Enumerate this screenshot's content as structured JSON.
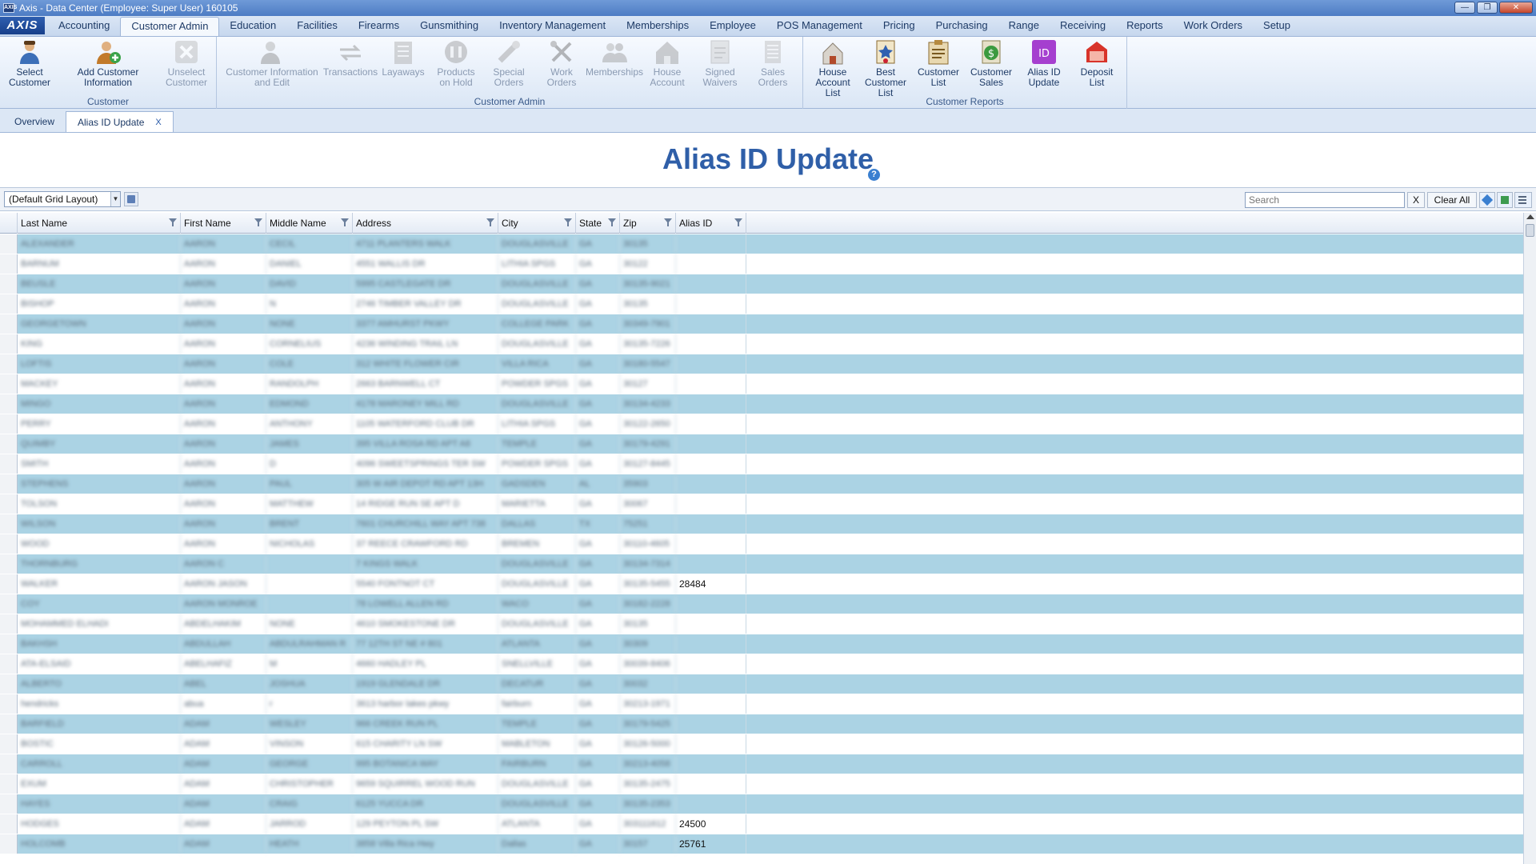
{
  "window": {
    "title": "Axis - Data Center  (Employee: Super User) 160105",
    "app_icon": "AXIS",
    "minimize": "—",
    "maximize": "❐",
    "close": "✕"
  },
  "menu": {
    "logo": "AXIS",
    "tabs": [
      "Accounting",
      "Customer Admin",
      "Education",
      "Facilities",
      "Firearms",
      "Gunsmithing",
      "Inventory Management",
      "Memberships",
      "Employee",
      "POS Management",
      "Pricing",
      "Purchasing",
      "Range",
      "Receiving",
      "Reports",
      "Work Orders",
      "Setup"
    ],
    "active": "Customer Admin"
  },
  "ribbon": {
    "customer": {
      "label": "Customer",
      "buttons": [
        {
          "label": "Select Customer",
          "icon": "person-icon"
        },
        {
          "label": "Add Customer Information",
          "icon": "add-person-icon"
        },
        {
          "label": "Unselect Customer",
          "icon": "x-icon"
        }
      ]
    },
    "customer_admin": {
      "label": "Customer Admin",
      "buttons": [
        {
          "label": "Customer Information and Edit",
          "icon": "person-edit-icon"
        },
        {
          "label": "Transactions",
          "icon": "transactions-icon"
        },
        {
          "label": "Layaways",
          "icon": "layaway-icon"
        },
        {
          "label": "Products on Hold",
          "icon": "hold-icon"
        },
        {
          "label": "Special Orders",
          "icon": "special-order-icon"
        },
        {
          "label": "Work Orders",
          "icon": "tools-icon"
        },
        {
          "label": "Memberships",
          "icon": "memberships-icon"
        },
        {
          "label": "House Account",
          "icon": "house-icon"
        },
        {
          "label": "Signed Waivers",
          "icon": "waiver-icon"
        },
        {
          "label": "Sales Orders",
          "icon": "sales-order-icon"
        }
      ]
    },
    "customer_reports": {
      "label": "Customer Reports",
      "buttons": [
        {
          "label": "House Account List",
          "icon": "house-list-icon"
        },
        {
          "label": "Best Customer List",
          "icon": "best-customer-icon"
        },
        {
          "label": "Customer List",
          "icon": "customer-list-icon"
        },
        {
          "label": "Customer Sales",
          "icon": "customer-sales-icon"
        },
        {
          "label": "Alias ID Update",
          "icon": "id-icon",
          "badge": "ID"
        },
        {
          "label": "Deposit List",
          "icon": "deposit-icon"
        }
      ]
    }
  },
  "doc_tabs": {
    "overview": "Overview",
    "alias": "Alias ID Update",
    "close": "X"
  },
  "page": {
    "title": "Alias ID Update",
    "help": "?"
  },
  "toolbar": {
    "layout": "(Default Grid Layout)",
    "search_placeholder": "Search",
    "clear_x": "X",
    "clear_all": "Clear All"
  },
  "grid": {
    "columns": [
      "Last Name",
      "First Name",
      "Middle Name",
      "Address",
      "City",
      "State",
      "Zip",
      "Alias ID"
    ],
    "rows": [
      [
        "ALEXANDER",
        "AARON",
        "CECIL",
        "4711 PLANTERS WALK",
        "DOUGLASVILLE",
        "GA",
        "30135",
        ""
      ],
      [
        "BARNUM",
        "AARON",
        "DANIEL",
        "4551 WALLIS DR",
        "LITHIA SPGS",
        "GA",
        "30122",
        ""
      ],
      [
        "BEUSLE",
        "AARON",
        "DAVID",
        "5995 CASTLEGATE DR",
        "DOUGLASVILLE",
        "GA",
        "30135-9021",
        ""
      ],
      [
        "BISHOP",
        "AARON",
        "N",
        "2746 TIMBER VALLEY DR",
        "DOUGLASVILLE",
        "GA",
        "30135",
        ""
      ],
      [
        "GEORGETOWN",
        "AARON",
        "NONE",
        "3377 AMHURST PKWY",
        "COLLEGE PARK",
        "GA",
        "30349-7901",
        ""
      ],
      [
        "KING",
        "AARON",
        "CORNELIUS",
        "4236 WINDING TRAIL LN",
        "DOUGLASVILLE",
        "GA",
        "30135-7226",
        ""
      ],
      [
        "LOFTIS",
        "AARON",
        "COLE",
        "312 WHITE FLOWER CIR",
        "VILLA RICA",
        "GA",
        "30180-5547",
        ""
      ],
      [
        "MACKEY",
        "AARON",
        "RANDOLPH",
        "2663 BARNWELL CT",
        "POWDER SPGS",
        "GA",
        "30127",
        ""
      ],
      [
        "MINGO",
        "AARON",
        "EDMOND",
        "4178 MARONEY MILL RD",
        "DOUGLASVILLE",
        "GA",
        "30134-4233",
        ""
      ],
      [
        "PERRY",
        "AARON",
        "ANTHONY",
        "1105 WATERFORD CLUB DR",
        "LITHIA SPGS",
        "GA",
        "30122-2650",
        ""
      ],
      [
        "QUIMBY",
        "AARON",
        "JAMES",
        "395 VILLA ROSA RD APT A8",
        "TEMPLE",
        "GA",
        "30179-4291",
        ""
      ],
      [
        "SMITH",
        "AARON",
        "D",
        "4096 SWEETSPRINGS TER SW",
        "POWDER SPGS",
        "GA",
        "30127-8445",
        ""
      ],
      [
        "STEPHENS",
        "AARON",
        "PAUL",
        "305 W AIR DEPOT RD APT 13H",
        "GADSDEN",
        "AL",
        "35903",
        ""
      ],
      [
        "TOLSON",
        "AARON",
        "MATTHEW",
        "14 RIDGE RUN SE APT D",
        "MARIETTA",
        "GA",
        "30067",
        ""
      ],
      [
        "WILSON",
        "AARON",
        "BRENT",
        "7601 CHURCHILL WAY APT 738",
        "DALLAS",
        "TX",
        "75251",
        ""
      ],
      [
        "WOOD",
        "AARON",
        "NICHOLAS",
        "37 REECE CRAWFORD RD",
        "BREMEN",
        "GA",
        "30110-4605",
        ""
      ],
      [
        "THORNBURG",
        "AARON C",
        "",
        "7 KINGS WALK",
        "DOUGLASVILLE",
        "GA",
        "30134-7314",
        ""
      ],
      [
        "WALKER",
        "AARON JASON",
        "",
        "5540 FONTNOT CT",
        "DOUGLASVILLE",
        "GA",
        "30135-5455",
        "28484"
      ],
      [
        "COY",
        "AARON MONROE",
        "",
        "78 LOWELL ALLEN RD",
        "WACO",
        "GA",
        "30182-2228",
        ""
      ],
      [
        "MOHAMMED ELHADI",
        "ABDELHAKIM",
        "NONE",
        "4610 SMOKESTONE DR",
        "DOUGLASVILLE",
        "GA",
        "30135",
        ""
      ],
      [
        "BAKHSH",
        "ABDULLAH",
        "ABDULRAHMAN R",
        "77 12TH ST NE # 801",
        "ATLANTA",
        "GA",
        "30309",
        ""
      ],
      [
        "ATA-ELSAID",
        "ABELHAFIZ",
        "M",
        "4660 HADLEY PL",
        "SNELLVILLE",
        "GA",
        "30039-8406",
        ""
      ],
      [
        "ALBERTO",
        "ABEL",
        "JOSHUA",
        "1919 GLENDALE DR",
        "DECATUR",
        "GA",
        "30032",
        ""
      ],
      [
        "hendricks",
        "abua",
        "r",
        "3613 harbor lakes pkwy",
        "fairburn",
        "GA",
        "30213-1971",
        ""
      ],
      [
        "BARFIELD",
        "ADAM",
        "WESLEY",
        "966 CREEK RUN PL",
        "TEMPLE",
        "GA",
        "30179-5425",
        ""
      ],
      [
        "BOSTIC",
        "ADAM",
        "VINSON",
        "615 CHARITY LN SW",
        "MABLETON",
        "GA",
        "30126-5000",
        ""
      ],
      [
        "CARROLL",
        "ADAM",
        "GEORGE",
        "995 BOTANICA WAY",
        "FAIRBURN",
        "GA",
        "30213-4058",
        ""
      ],
      [
        "EXUM",
        "ADAM",
        "CHRISTOPHER",
        "9659 SQUIRREL WOOD RUN",
        "DOUGLASVILLE",
        "GA",
        "30135-2475",
        ""
      ],
      [
        "HAYES",
        "ADAM",
        "CRAIG",
        "6125 YUCCA DR",
        "DOUGLASVILLE",
        "GA",
        "30135-2353",
        ""
      ],
      [
        "HODGES",
        "ADAM",
        "JARROD",
        "129 PEYTON PL SW",
        "ATLANTA",
        "GA",
        "303111612",
        "24500"
      ],
      [
        "HOLCOMB",
        "ADAM",
        "HEATH",
        "3858 Villa Rica Hwy",
        "Dallas",
        "GA",
        "30157",
        "25761"
      ]
    ]
  }
}
